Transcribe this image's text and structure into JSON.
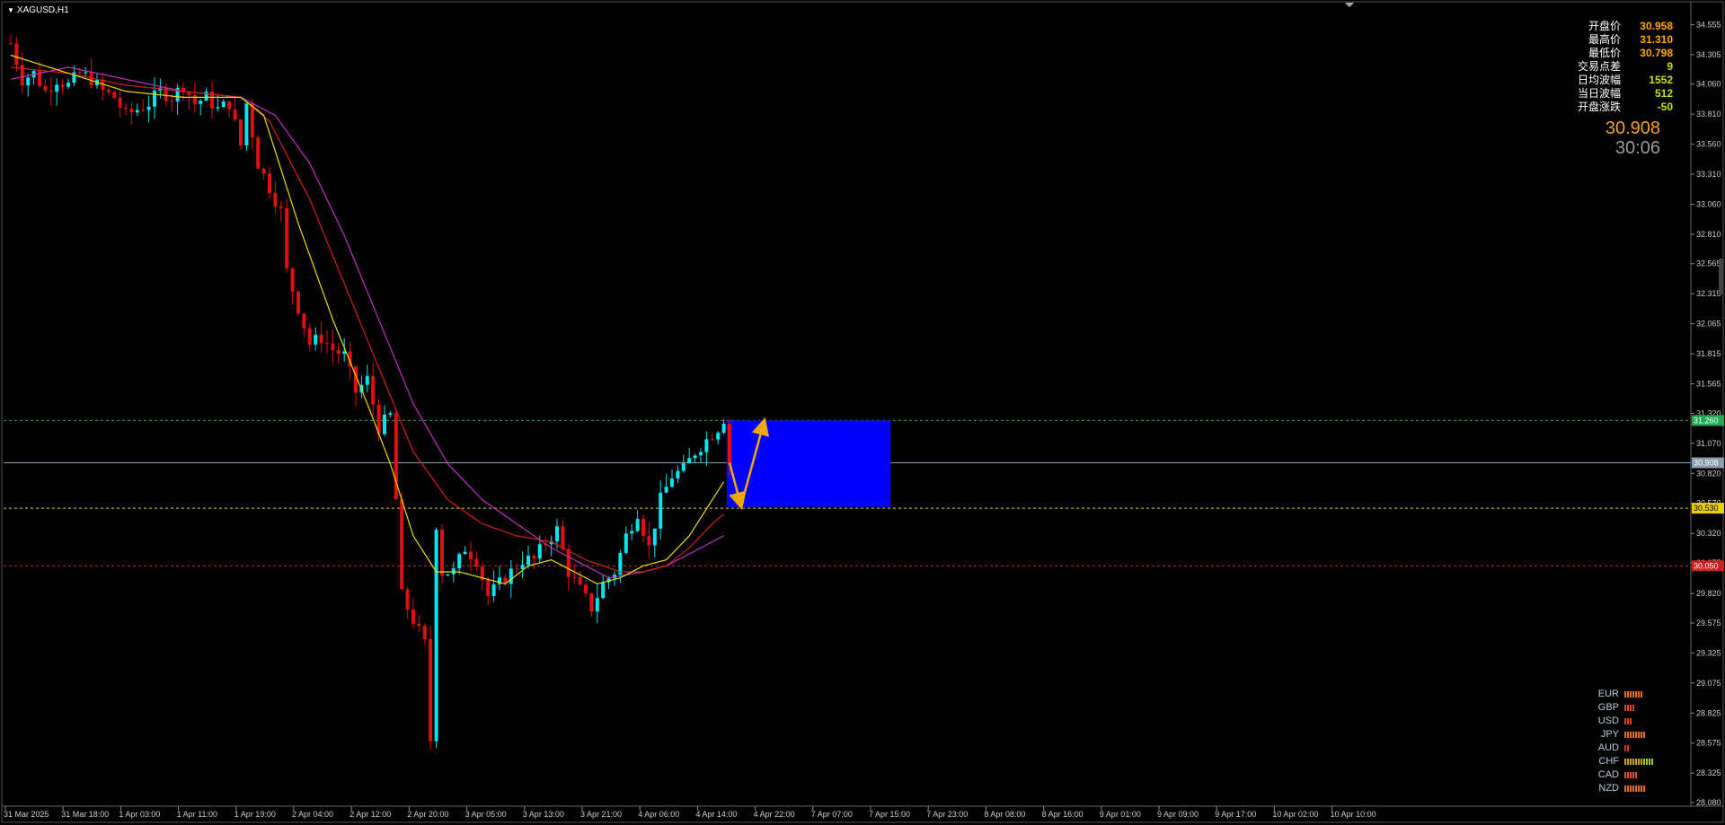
{
  "symbol_title": "XAGUSD,H1",
  "stats": [
    {
      "label": "开盘价",
      "value": "30.958",
      "color": "#ffa800"
    },
    {
      "label": "最高价",
      "value": "31.310",
      "color": "#ffa800"
    },
    {
      "label": "最低价",
      "value": "30.798",
      "color": "#ffa800"
    },
    {
      "label": "交易点差",
      "value": "9",
      "color": "#c8e000"
    },
    {
      "label": "日均波幅",
      "value": "1552",
      "color": "#c8e000"
    },
    {
      "label": "当日波幅",
      "value": "512",
      "color": "#c8e000"
    },
    {
      "label": "开盘涨跌",
      "value": "-50",
      "color": "#c8e000"
    }
  ],
  "current_price": "30.908",
  "countdown": "30:06",
  "price_axis": [
    "34.555",
    "34.305",
    "34.060",
    "33.810",
    "33.560",
    "33.310",
    "33.060",
    "32.810",
    "32.565",
    "32.315",
    "32.065",
    "31.815",
    "31.565",
    "31.320",
    "31.070",
    "30.820",
    "30.570",
    "30.320",
    "30.075",
    "29.820",
    "29.575",
    "29.325",
    "29.075",
    "28.825",
    "28.575",
    "28.325",
    "28.080"
  ],
  "time_axis": [
    "31 Mar 2025",
    "31 Mar 18:00",
    "1 Apr 03:00",
    "1 Apr 11:00",
    "1 Apr 19:00",
    "2 Apr 04:00",
    "2 Apr 12:00",
    "2 Apr 20:00",
    "3 Apr 05:00",
    "3 Apr 13:00",
    "3 Apr 21:00",
    "4 Apr 06:00",
    "4 Apr 14:00",
    "4 Apr 22:00",
    "7 Apr 07:00",
    "7 Apr 15:00",
    "7 Apr 23:00",
    "8 Apr 08:00",
    "8 Apr 16:00",
    "9 Apr 01:00",
    "9 Apr 09:00",
    "9 Apr 17:00",
    "10 Apr 02:00",
    "10 Apr 10:00"
  ],
  "levels": [
    {
      "name": "resistance",
      "value": 31.26,
      "label": "31.260",
      "color": "#22aa55"
    },
    {
      "name": "current",
      "value": 30.908,
      "label": "30.908",
      "color": "#8a9ab0"
    },
    {
      "name": "support",
      "value": 30.53,
      "label": "30.530",
      "color": "#e8d000"
    },
    {
      "name": "low-level",
      "value": 30.05,
      "label": "30.050",
      "color": "#cc2020"
    }
  ],
  "colors": {
    "bull": "#00e5ee",
    "bear": "#e01010",
    "ma_fast": "#e8e000",
    "ma_mid": "#d02020",
    "ma_slow": "#c030c0",
    "box": "#0000ff",
    "arrow": "#f0a800"
  },
  "currency_strength": [
    {
      "name": "EUR",
      "bars": 7,
      "color": "#e07020"
    },
    {
      "name": "GBP",
      "bars": 4,
      "color": "#e04020"
    },
    {
      "name": "USD",
      "bars": 3,
      "color": "#e04020"
    },
    {
      "name": "JPY",
      "bars": 8,
      "color": "#e07020"
    },
    {
      "name": "AUD",
      "bars": 2,
      "color": "#e03020"
    },
    {
      "name": "CHF",
      "bars": 11,
      "color": "#c8a020"
    },
    {
      "name": "CAD",
      "bars": 5,
      "color": "#e05020"
    },
    {
      "name": "NZD",
      "bars": 8,
      "color": "#e07020"
    }
  ],
  "chart_data": {
    "type": "candlestick",
    "symbol": "XAGUSD",
    "timeframe": "H1",
    "ylim": [
      28.05,
      34.7
    ],
    "close_path": [
      [
        0,
        34.4
      ],
      [
        2,
        34.1
      ],
      [
        4,
        34.15
      ],
      [
        6,
        34.0
      ],
      [
        8,
        34.1
      ],
      [
        10,
        34.05
      ],
      [
        12,
        34.15
      ],
      [
        14,
        34.1
      ],
      [
        16,
        34.0
      ],
      [
        18,
        33.95
      ],
      [
        20,
        33.8
      ],
      [
        22,
        33.85
      ],
      [
        24,
        33.9
      ],
      [
        26,
        34.0
      ],
      [
        28,
        33.95
      ],
      [
        30,
        34.05
      ],
      [
        32,
        33.9
      ],
      [
        34,
        33.95
      ],
      [
        36,
        33.85
      ],
      [
        38,
        33.9
      ],
      [
        40,
        33.55
      ],
      [
        41,
        33.9
      ],
      [
        43,
        33.4
      ],
      [
        45,
        33.2
      ],
      [
        47,
        33.0
      ],
      [
        48,
        32.5
      ],
      [
        50,
        32.2
      ],
      [
        52,
        31.9
      ],
      [
        54,
        31.95
      ],
      [
        56,
        31.85
      ],
      [
        58,
        31.8
      ],
      [
        60,
        31.5
      ],
      [
        62,
        31.6
      ],
      [
        64,
        31.2
      ],
      [
        66,
        31.3
      ],
      [
        67,
        30.6
      ],
      [
        68,
        29.8
      ],
      [
        70,
        29.6
      ],
      [
        72,
        29.4
      ],
      [
        73,
        28.6
      ],
      [
        74,
        30.4
      ],
      [
        75,
        30.0
      ],
      [
        77,
        30.0
      ],
      [
        79,
        30.2
      ],
      [
        81,
        30.1
      ],
      [
        83,
        29.8
      ],
      [
        85,
        29.9
      ],
      [
        87,
        30.0
      ],
      [
        89,
        30.1
      ],
      [
        91,
        30.1
      ],
      [
        93,
        30.25
      ],
      [
        95,
        30.35
      ],
      [
        97,
        30.0
      ],
      [
        99,
        29.85
      ],
      [
        101,
        29.7
      ],
      [
        103,
        29.9
      ],
      [
        105,
        30.0
      ],
      [
        107,
        30.3
      ],
      [
        109,
        30.5
      ],
      [
        111,
        30.2
      ],
      [
        113,
        30.6
      ],
      [
        115,
        30.8
      ],
      [
        117,
        30.85
      ],
      [
        119,
        31.0
      ],
      [
        121,
        31.1
      ],
      [
        123,
        31.2
      ],
      [
        124,
        31.28
      ],
      [
        125,
        30.9
      ]
    ],
    "ma_fast": [
      [
        0,
        34.3
      ],
      [
        10,
        34.15
      ],
      [
        20,
        34.0
      ],
      [
        30,
        33.95
      ],
      [
        40,
        33.95
      ],
      [
        44,
        33.8
      ],
      [
        50,
        32.9
      ],
      [
        56,
        32.1
      ],
      [
        62,
        31.4
      ],
      [
        66,
        30.9
      ],
      [
        70,
        30.3
      ],
      [
        74,
        30.0
      ],
      [
        78,
        30.0
      ],
      [
        82,
        29.95
      ],
      [
        86,
        29.9
      ],
      [
        90,
        30.05
      ],
      [
        94,
        30.1
      ],
      [
        98,
        30.0
      ],
      [
        102,
        29.9
      ],
      [
        106,
        29.95
      ],
      [
        110,
        30.05
      ],
      [
        114,
        30.1
      ],
      [
        118,
        30.3
      ],
      [
        122,
        30.6
      ],
      [
        124,
        30.75
      ]
    ],
    "ma_mid": [
      [
        0,
        34.2
      ],
      [
        10,
        34.15
      ],
      [
        20,
        34.05
      ],
      [
        30,
        34.0
      ],
      [
        40,
        33.95
      ],
      [
        45,
        33.75
      ],
      [
        52,
        33.1
      ],
      [
        58,
        32.4
      ],
      [
        64,
        31.7
      ],
      [
        70,
        31.0
      ],
      [
        76,
        30.6
      ],
      [
        82,
        30.4
      ],
      [
        88,
        30.3
      ],
      [
        94,
        30.25
      ],
      [
        100,
        30.1
      ],
      [
        106,
        30.0
      ],
      [
        110,
        30.0
      ],
      [
        114,
        30.05
      ],
      [
        118,
        30.2
      ],
      [
        122,
        30.4
      ],
      [
        124,
        30.48
      ]
    ],
    "ma_slow": [
      [
        0,
        34.1
      ],
      [
        10,
        34.2
      ],
      [
        20,
        34.1
      ],
      [
        30,
        34.0
      ],
      [
        40,
        33.95
      ],
      [
        46,
        33.8
      ],
      [
        52,
        33.4
      ],
      [
        58,
        32.8
      ],
      [
        64,
        32.1
      ],
      [
        70,
        31.4
      ],
      [
        76,
        30.9
      ],
      [
        82,
        30.6
      ],
      [
        88,
        30.4
      ],
      [
        94,
        30.2
      ],
      [
        100,
        30.05
      ],
      [
        104,
        29.95
      ],
      [
        110,
        30.0
      ],
      [
        114,
        30.05
      ],
      [
        118,
        30.15
      ],
      [
        122,
        30.25
      ],
      [
        124,
        30.3
      ]
    ],
    "projection": [
      [
        125,
        30.908
      ],
      [
        127,
        30.55
      ],
      [
        131,
        31.25
      ]
    ]
  }
}
